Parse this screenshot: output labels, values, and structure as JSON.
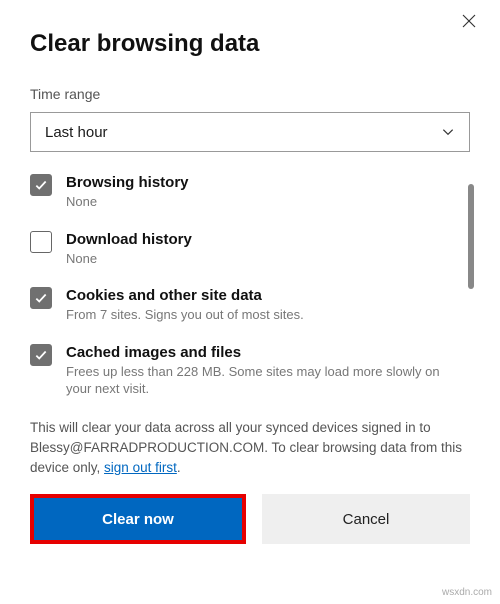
{
  "title": "Clear browsing data",
  "timeRange": {
    "label": "Time range",
    "selected": "Last hour"
  },
  "items": [
    {
      "checked": true,
      "title": "Browsing history",
      "sub": "None"
    },
    {
      "checked": false,
      "title": "Download history",
      "sub": "None"
    },
    {
      "checked": true,
      "title": "Cookies and other site data",
      "sub": "From 7 sites. Signs you out of most sites."
    },
    {
      "checked": true,
      "title": "Cached images and files",
      "sub": "Frees up less than 228 MB. Some sites may load more slowly on your next visit."
    }
  ],
  "notice": {
    "prefix": "This will clear your data across all your synced devices signed in to Blessy@FARRADPRODUCTION.COM. To clear browsing data from this device only, ",
    "link": "sign out first",
    "suffix": "."
  },
  "buttons": {
    "primary": "Clear now",
    "secondary": "Cancel"
  },
  "watermark": "wsxdn.com"
}
